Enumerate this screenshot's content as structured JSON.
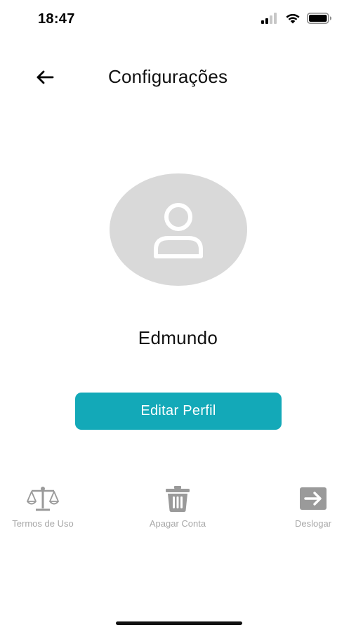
{
  "status_bar": {
    "time": "18:47",
    "icons": [
      "signal-icon",
      "wifi-icon",
      "battery-icon"
    ]
  },
  "header": {
    "back_icon": "arrow-left-icon",
    "title": "Configurações"
  },
  "profile": {
    "avatar_icon": "user-icon",
    "name": "Edmundo"
  },
  "edit_button": {
    "label": "Editar Perfil"
  },
  "actions": [
    {
      "icon": "scale-icon",
      "label": "Termos de Uso"
    },
    {
      "icon": "trash-icon",
      "label": "Apagar Conta"
    },
    {
      "icon": "logout-arrow-icon",
      "label": "Deslogar"
    }
  ],
  "colors": {
    "accent": "#13a9b8",
    "avatar_bg": "#d9d9d9",
    "action_icon": "#9a9a9a",
    "action_label": "#a8a8a8"
  }
}
